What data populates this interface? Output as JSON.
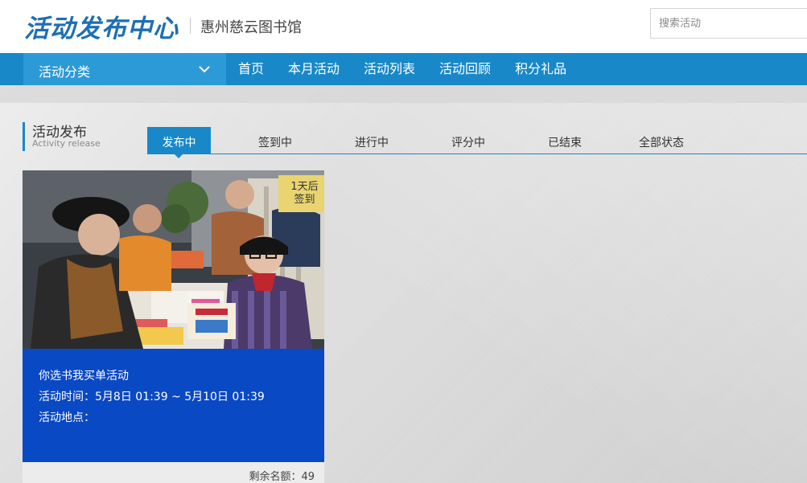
{
  "header": {
    "logo_text": "活动发布中心",
    "library_name": "惠州慈云图书馆",
    "search_placeholder": "搜索活动"
  },
  "nav": {
    "category_label": "活动分类",
    "items": [
      {
        "label": "首页"
      },
      {
        "label": "本月活动"
      },
      {
        "label": "活动列表"
      },
      {
        "label": "活动回顾"
      },
      {
        "label": "积分礼品"
      }
    ]
  },
  "section": {
    "title": "活动发布",
    "subtitle": "Activity release",
    "tabs": [
      {
        "label": "发布中",
        "active": true
      },
      {
        "label": "签到中"
      },
      {
        "label": "进行中"
      },
      {
        "label": "评分中"
      },
      {
        "label": "已结束"
      },
      {
        "label": "全部状态"
      }
    ]
  },
  "activity": {
    "badge_line1": "1天后",
    "badge_line2": "签到",
    "title": "你选书我买单活动",
    "time": "活动时间：5月8日 01:39 ~ 5月10日 01:39",
    "location": "活动地点：",
    "remaining": "剩余名额：49"
  },
  "colors": {
    "brand_blue": "#1888c8",
    "logo_blue": "#1d6fb3",
    "card_blue": "#0a49c4",
    "badge_yellow": "#e9d471"
  }
}
